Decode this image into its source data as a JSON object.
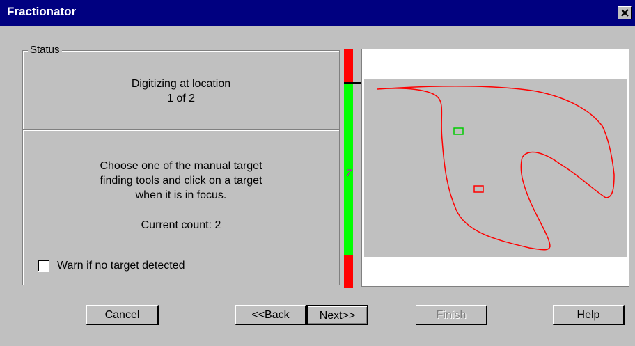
{
  "window": {
    "title": "Fractionator",
    "close_symbol": "✕"
  },
  "status": {
    "group_label": "Status",
    "location_line1": "Digitizing at location",
    "location_line2": "1 of 2",
    "instruction_line1": "Choose one of the manual target",
    "instruction_line2": "finding tools and click on a target",
    "instruction_line3": "when it is in focus.",
    "current_count": "Current count: 2",
    "warn_checkbox_label": "Warn if no target detected",
    "warn_checked": false
  },
  "focus_bar": {
    "label": "7",
    "colors": {
      "out_of_range": "#ff0000",
      "in_range": "#00ff00",
      "marker": "#000000"
    }
  },
  "preview": {
    "contour_color": "#ff0000",
    "counted_marker_color": "#00cc00",
    "current_marker_color": "#ff0000"
  },
  "buttons": {
    "cancel": "Cancel",
    "back": "<<Back",
    "next": "Next>>",
    "finish": "Finish",
    "help": "Help"
  }
}
